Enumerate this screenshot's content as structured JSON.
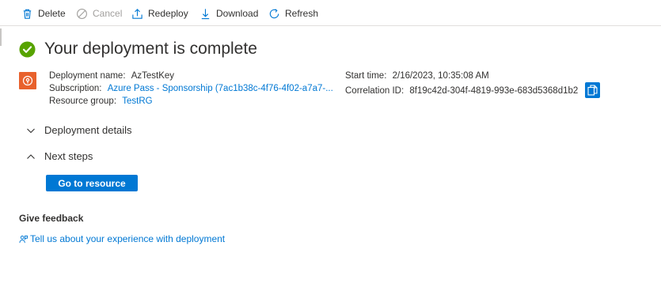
{
  "toolbar": {
    "delete_label": "Delete",
    "cancel_label": "Cancel",
    "redeploy_label": "Redeploy",
    "download_label": "Download",
    "refresh_label": "Refresh"
  },
  "header": {
    "title": "Your deployment is complete"
  },
  "details": {
    "deployment_name_label": "Deployment name:",
    "deployment_name": "AzTestKey",
    "subscription_label": "Subscription:",
    "subscription": "Azure Pass - Sponsorship (7ac1b38c-4f76-4f02-a7a7-...",
    "resource_group_label": "Resource group:",
    "resource_group": "TestRG",
    "start_time_label": "Start time:",
    "start_time": "2/16/2023, 10:35:08 AM",
    "correlation_id_label": "Correlation ID:",
    "correlation_id": "8f19c42d-304f-4819-993e-683d5368d1b2"
  },
  "sections": {
    "deployment_details": "Deployment details",
    "next_steps": "Next steps",
    "go_to_resource": "Go to resource"
  },
  "feedback": {
    "title": "Give feedback",
    "link": "Tell us about your experience with deployment"
  },
  "colors": {
    "accent": "#0078d4",
    "success": "#57a300",
    "resource_icon": "#e8612c"
  },
  "icons": {
    "delete": "trash-icon",
    "cancel": "cancel-icon",
    "redeploy": "upload-icon",
    "download": "download-icon",
    "refresh": "refresh-icon",
    "status": "check-circle-icon",
    "resource": "key-vault-icon",
    "copy": "copy-icon",
    "feedback": "people-feedback-icon"
  }
}
